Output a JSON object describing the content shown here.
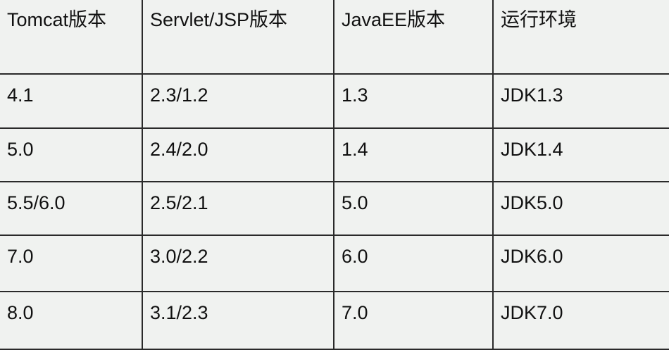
{
  "table": {
    "headers": [
      "Tomcat版本",
      "Servlet/JSP版本",
      "JavaEE版本",
      "运行环境"
    ],
    "rows": [
      [
        "4.1",
        "2.3/1.2",
        "1.3",
        "JDK1.3"
      ],
      [
        "5.0",
        "2.4/2.0",
        "1.4",
        "JDK1.4"
      ],
      [
        "5.5/6.0",
        "2.5/2.1",
        "5.0",
        "JDK5.0"
      ],
      [
        "7.0",
        "3.0/2.2",
        "6.0",
        "JDK6.0"
      ],
      [
        "8.0",
        "3.1/2.3",
        "7.0",
        "JDK7.0"
      ]
    ]
  }
}
